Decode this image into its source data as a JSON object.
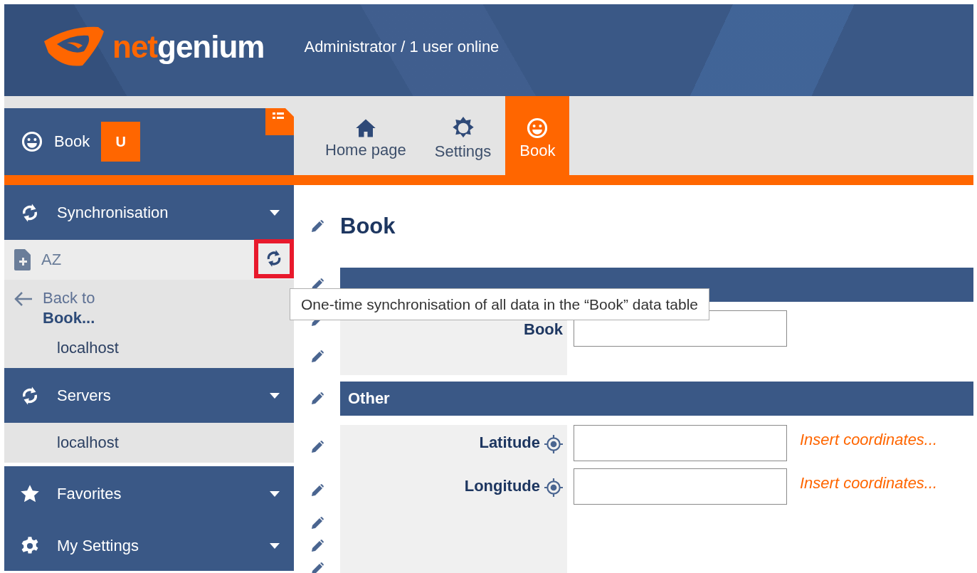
{
  "header": {
    "logo": {
      "first": "net",
      "second": "genium"
    },
    "user_status": "Administrator / 1 user online"
  },
  "app_badge": {
    "title": "Book",
    "letter": "U"
  },
  "tabs": [
    {
      "label": "Home page",
      "kind": "home",
      "selected": false
    },
    {
      "label": "Settings",
      "kind": "settings",
      "selected": false
    },
    {
      "label": "Book",
      "kind": "app",
      "selected": true
    }
  ],
  "sidebar": {
    "sections": [
      {
        "title": "Synchronisation",
        "kind": "sync",
        "toolbar": {
          "sort_label": "AZ",
          "sync_highlighted": true
        },
        "back_link": "Back to **Book...**",
        "items": [
          "localhost"
        ]
      },
      {
        "title": "Servers",
        "kind": "sync",
        "items": [
          "localhost"
        ]
      },
      {
        "title": "Favorites",
        "kind": "star"
      },
      {
        "title": "My Settings",
        "kind": "gear"
      }
    ]
  },
  "page_title": "Book",
  "form": {
    "sections": [
      {
        "fields": [
          {
            "label": "Book",
            "kind": "text"
          }
        ]
      },
      {
        "title": "Other",
        "fields": [
          {
            "label": "Latitude",
            "kind": "coordinates",
            "action": "Insert coordinates..."
          },
          {
            "label": "Longitude",
            "kind": "coordinates",
            "action": "Insert coordinates..."
          }
        ]
      }
    ]
  },
  "tooltip": "One-time synchronisation of all data in the “Book” data table"
}
